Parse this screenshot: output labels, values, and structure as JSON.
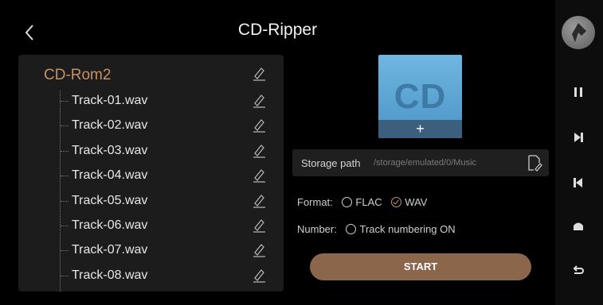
{
  "header": {
    "title": "CD-Ripper"
  },
  "tree": {
    "root": "CD-Rom2",
    "tracks": [
      "Track-01.wav",
      "Track-02.wav",
      "Track-03.wav",
      "Track-04.wav",
      "Track-05.wav",
      "Track-06.wav",
      "Track-07.wav",
      "Track-08.wav"
    ]
  },
  "cover": {
    "text": "CD",
    "add_label": "+"
  },
  "storage": {
    "label": "Storage path",
    "value": "/storage/emulated/0/Music"
  },
  "format": {
    "label": "Format:",
    "options": [
      "FLAC",
      "WAV"
    ],
    "selected": "WAV"
  },
  "number": {
    "label": "Number:",
    "option": "Track numbering ON",
    "checked": false
  },
  "start_label": "START",
  "colors": {
    "accent": "#c59166",
    "button": "#8b664b",
    "panel": "#1c1c1c",
    "cover": "#5ea6d6"
  },
  "sidebar_icons": [
    "app-logo-icon",
    "pause-icon",
    "next-track-icon",
    "previous-track-icon",
    "home-icon",
    "return-icon"
  ]
}
